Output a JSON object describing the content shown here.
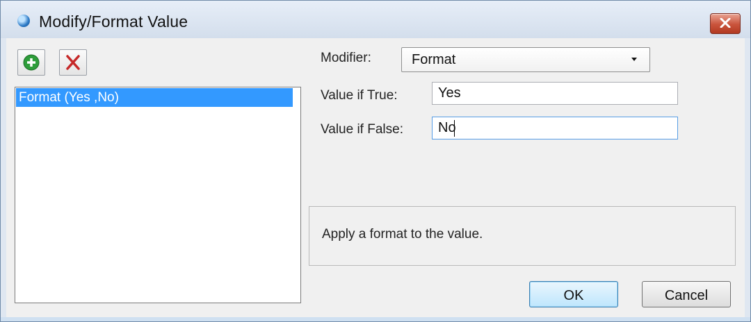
{
  "window": {
    "title": "Modify/Format Value"
  },
  "toolbar": {
    "add_icon": "add-circle-icon",
    "delete_icon": "delete-x-icon"
  },
  "modifiers_list": {
    "items": [
      {
        "label": "Format (Yes ,No)",
        "selected": true
      }
    ]
  },
  "form": {
    "modifier_label": "Modifier:",
    "modifier_value": "Format",
    "value_if_true_label": "Value if True:",
    "value_if_true": "Yes",
    "value_if_false_label": "Value if False:",
    "value_if_false": "No"
  },
  "description": {
    "text": "Apply a format to the value."
  },
  "buttons": {
    "ok": "OK",
    "cancel": "Cancel"
  },
  "colors": {
    "selection": "#3399ff",
    "close_button": "#c9533b",
    "add_icon": "#2e9d3a",
    "delete_icon": "#c62828"
  }
}
